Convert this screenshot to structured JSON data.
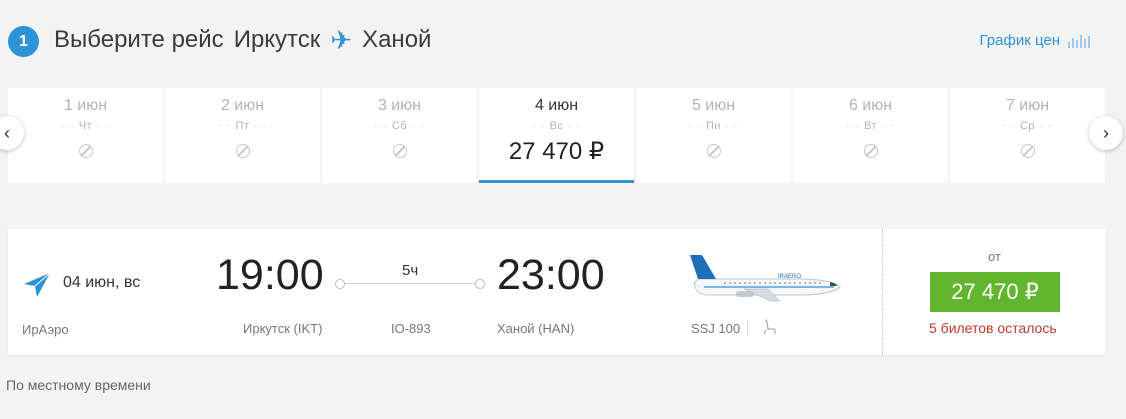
{
  "header": {
    "step": "1",
    "title_prefix": "Выберите рейс",
    "origin": "Иркутск",
    "plane_glyph": "✈",
    "destination": "Ханой",
    "price_chart_label": "График цен"
  },
  "date_nav": {
    "prev_glyph": "‹",
    "next_glyph": "›",
    "days": [
      {
        "day": "1 июн",
        "weekday": "Чт",
        "price": ""
      },
      {
        "day": "2 июн",
        "weekday": "Пт",
        "price": ""
      },
      {
        "day": "3 июн",
        "weekday": "Сб",
        "price": ""
      },
      {
        "day": "4 июн",
        "weekday": "Вс",
        "price": "27 470 ₽"
      },
      {
        "day": "5 июн",
        "weekday": "Пн",
        "price": ""
      },
      {
        "day": "6 июн",
        "weekday": "Вт",
        "price": ""
      },
      {
        "day": "7 июн",
        "weekday": "Ср",
        "price": ""
      }
    ],
    "selected_index": 3
  },
  "flight": {
    "date": "04 июн, вс",
    "airline": "ИрАэро",
    "departure_time": "19:00",
    "departure_airport": "Иркутск (IKT)",
    "duration": "5ч",
    "flight_number": "IO-893",
    "arrival_time": "23:00",
    "arrival_airport": "Ханой (HAN)",
    "aircraft_type": "SSJ 100",
    "aircraft_livery_text": "IRAERO",
    "from_label": "от",
    "price": "27 470 ₽",
    "tickets_left": "5 билетов осталось"
  },
  "footer": {
    "note": "По местному времени"
  },
  "colors": {
    "accent": "#2d93d7",
    "buy_button": "#62b52f",
    "warning_text": "#c0392b"
  }
}
